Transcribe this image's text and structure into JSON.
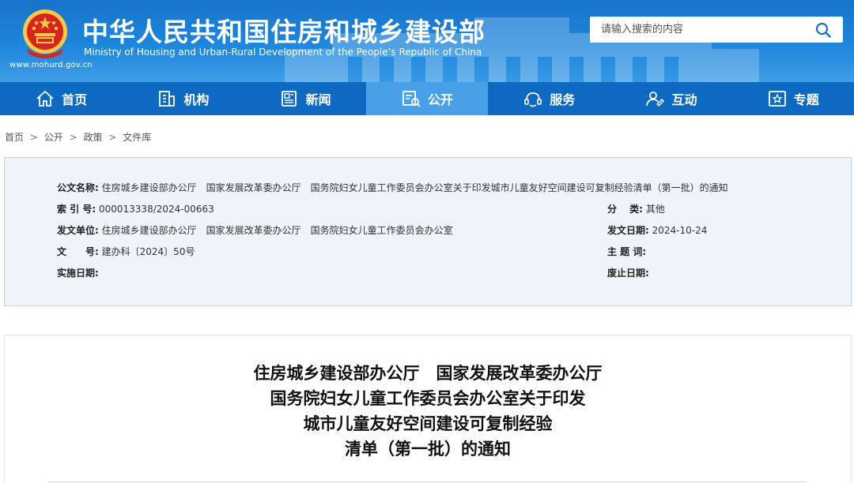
{
  "header": {
    "cn_title": "中华人民共和国住房和城乡建设部",
    "en_title": "Ministry of Housing and Urban-Rural Development of the People’s Republic of China",
    "site_url": "www.mohurd.gov.cn",
    "colors": {
      "primary": "#1673c9",
      "nav": "#0e69c2",
      "nav_active": "#4aa0e6",
      "emblem_red": "#d7261e",
      "emblem_gold": "#f6c94a"
    }
  },
  "search": {
    "placeholder": "请输入搜索的内容",
    "icon": "search-icon"
  },
  "nav": {
    "items": [
      {
        "label": "首页",
        "icon": "home-icon"
      },
      {
        "label": "机构",
        "icon": "building-icon"
      },
      {
        "label": "新闻",
        "icon": "news-icon"
      },
      {
        "label": "公开",
        "icon": "disclosure-icon",
        "active": true
      },
      {
        "label": "服务",
        "icon": "service-icon"
      },
      {
        "label": "互动",
        "icon": "interaction-icon"
      },
      {
        "label": "专题",
        "icon": "special-topic-icon"
      }
    ]
  },
  "breadcrumb": {
    "items": [
      "首页",
      "公开",
      "政策",
      "文件库"
    ],
    "separator": ">"
  },
  "meta": {
    "doc_name_label": "公文名称:",
    "doc_name_value": "住房城乡建设部办公厅　国家发展改革委办公厅　国务院妇女儿童工作委员会办公室关于印发城市儿童友好空间建设可复制经验清单（第一批）的通知",
    "index_label": "索 引 号:",
    "index_value": "000013338/2024-00663",
    "category_label": "分　 类:",
    "category_value": "其他",
    "issuer_label": "发文单位:",
    "issuer_value": "住房城乡建设部办公厅　国家发展改革委办公厅　国务院妇女儿童工作委员会办公室",
    "date_label": "发文日期:",
    "date_value": "2024-10-24",
    "docno_label": "文　　号:",
    "docno_value": "建办科〔2024〕50号",
    "keywords_label": "主 题 词:",
    "keywords_value": "",
    "effective_label": "实施日期:",
    "effective_value": "",
    "expiry_label": "废止日期:",
    "expiry_value": ""
  },
  "document": {
    "title_lines": [
      "住房城乡建设部办公厅　国家发展改革委办公厅",
      "国务院妇女儿童工作委员会办公室关于印发",
      "城市儿童友好空间建设可复制经验",
      "清单（第一批）的通知"
    ]
  }
}
